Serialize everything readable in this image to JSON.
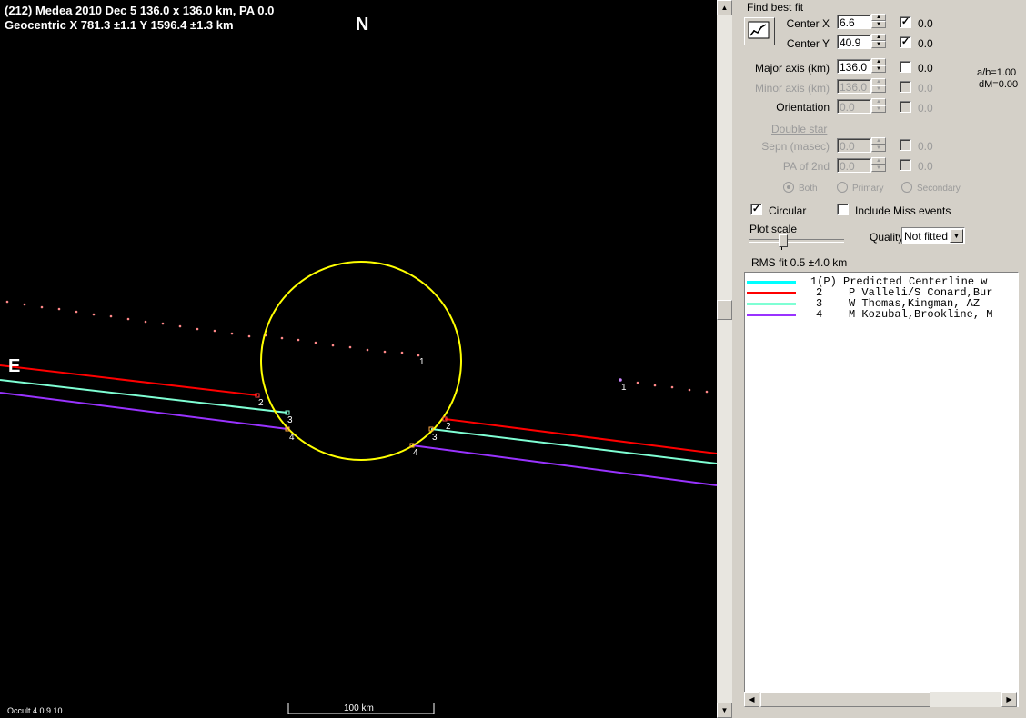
{
  "plot": {
    "title_line1": "(212) Medea  2010 Dec 5   136.0 x 136.0 km,  PA 0.0",
    "title_line2": "Geocentric  X  781.3 ±1.1   Y 1596.4 ±1.3 km",
    "north_label": "N",
    "east_label": "E",
    "version": "Occult 4.0.9.10",
    "scale_label": "100 km",
    "ellipse_color": "#ffff00",
    "chords": [
      {
        "id": "1",
        "color": "#ff8888"
      },
      {
        "id": "2",
        "color": "#ff0000"
      },
      {
        "id": "3",
        "color": "#7fffd4"
      },
      {
        "id": "4",
        "color": "#9933ff"
      }
    ]
  },
  "panel": {
    "group_title": "Find best fit",
    "center_x": {
      "label": "Center X",
      "value": "6.6",
      "checked": true,
      "uncert": "0.0"
    },
    "center_y": {
      "label": "Center Y",
      "value": "40.9",
      "checked": true,
      "uncert": "0.0"
    },
    "major_axis": {
      "label": "Major axis (km)",
      "value": "136.0",
      "checked": false,
      "uncert": "0.0"
    },
    "minor_axis": {
      "label": "Minor axis (km)",
      "value": "136.0",
      "checked": false,
      "uncert": "0.0"
    },
    "orientation": {
      "label": "Orientation",
      "value": "0.0",
      "checked": false,
      "uncert": "0.0"
    },
    "ab_ratio": "a/b=1.00",
    "dm": "dM=0.00",
    "double_star": "Double star",
    "sepn": {
      "label": "Sepn (masec)",
      "value": "0.0",
      "uncert": "0.0"
    },
    "pa2nd": {
      "label": "PA of 2nd",
      "value": "0.0",
      "uncert": "0.0"
    },
    "radio_both": "Both",
    "radio_primary": "Primary",
    "radio_secondary": "Secondary",
    "circular": "Circular",
    "include_miss": "Include Miss events",
    "plot_scale": "Plot scale",
    "quality_label": "Quality",
    "quality_value": "Not fitted",
    "rms": "RMS fit 0.5 ±4.0 km",
    "legend": [
      {
        "num": "1(P)",
        "text": "Predicted Centerline w",
        "color": "#00ffff"
      },
      {
        "num": "2",
        "text": "P Valleli/S Conard,Bur",
        "color": "#ff0000"
      },
      {
        "num": "3",
        "text": "W Thomas,Kingman, AZ",
        "color": "#7fffd4"
      },
      {
        "num": "4",
        "text": "M Kozubal,Brookline, M",
        "color": "#9933ff"
      }
    ]
  }
}
